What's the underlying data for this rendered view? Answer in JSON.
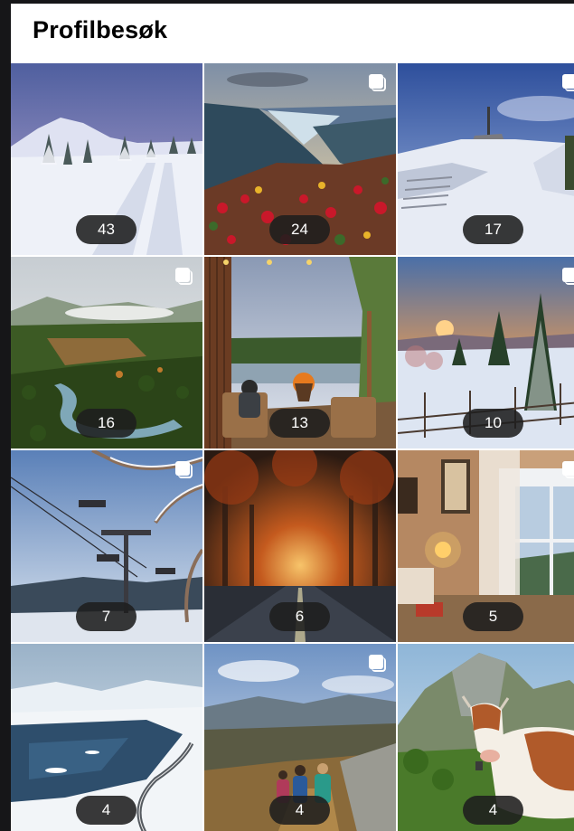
{
  "header": {
    "title": "Profilbesøk"
  },
  "posts": [
    {
      "visits": "43",
      "multi": false,
      "icon": "snowy-ski-trail-photo"
    },
    {
      "visits": "24",
      "multi": true,
      "icon": "fjord-valley-photo"
    },
    {
      "visits": "17",
      "multi": true,
      "icon": "snowy-summit-tower-photo"
    },
    {
      "visits": "16",
      "multi": true,
      "icon": "forest-river-valley-photo"
    },
    {
      "visits": "13",
      "multi": false,
      "icon": "cabin-terrace-lake-photo"
    },
    {
      "visits": "10",
      "multi": true,
      "icon": "winter-sunset-forest-photo"
    },
    {
      "visits": "7",
      "multi": true,
      "icon": "chairlift-frosty-branches-photo"
    },
    {
      "visits": "6",
      "multi": false,
      "icon": "autumn-tree-tunnel-road-photo"
    },
    {
      "visits": "5",
      "multi": true,
      "icon": "cozy-window-room-photo"
    },
    {
      "visits": "4",
      "multi": false,
      "icon": "frozen-lake-road-photo"
    },
    {
      "visits": "4",
      "multi": true,
      "icon": "hikers-mountain-view-photo"
    },
    {
      "visits": "4",
      "multi": false,
      "icon": "cow-mountain-photo"
    }
  ]
}
